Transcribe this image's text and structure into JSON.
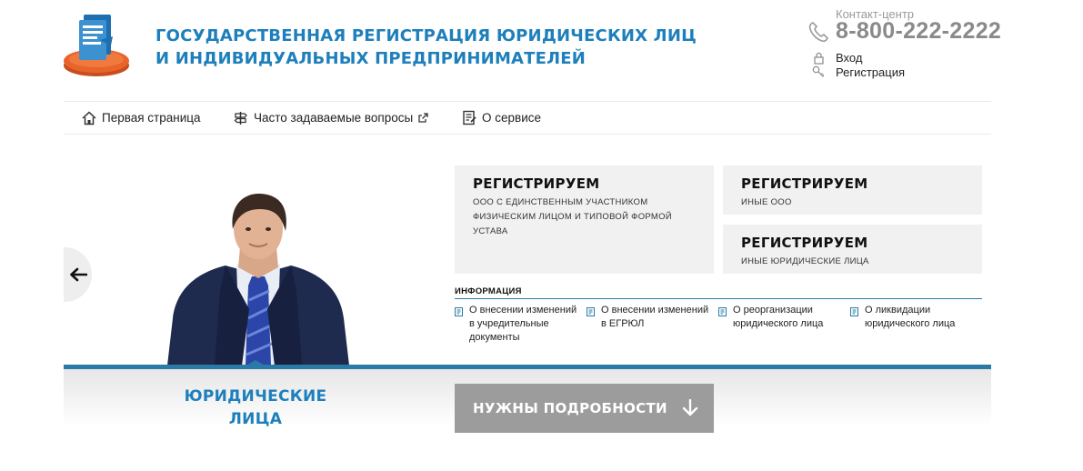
{
  "header": {
    "title_line1": "ГОСУДАРСТВЕННАЯ РЕГИСТРАЦИЯ ЮРИДИЧЕСКИХ ЛИЦ",
    "title_line2": "И ИНДИВИДУАЛЬНЫХ ПРЕДПРИНИМАТЕЛЕЙ",
    "contact_label": "Контакт-центр",
    "phone": "8-800-222-2222",
    "login_label": "Вход",
    "register_label": "Регистрация"
  },
  "nav": {
    "items": [
      {
        "label": "Первая страница",
        "icon": "home-icon"
      },
      {
        "label": "Часто задаваемые вопросы",
        "icon": "signpost-icon"
      },
      {
        "label": "О сервисе",
        "icon": "document-icon"
      }
    ]
  },
  "cards": [
    {
      "title": "РЕГИСТРИРУЕМ",
      "desc": "ООО С ЕДИНСТВЕННЫМ УЧАСТНИКОМ ФИЗИЧЕСКИМ ЛИЦОМ И ТИПОВОЙ ФОРМОЙ УСТАВА"
    },
    {
      "title": "РЕГИСТРИРУЕМ",
      "desc": "ИНЫЕ ООО"
    },
    {
      "title": "РЕГИСТРИРУЕМ",
      "desc": "ИНЫЕ ЮРИДИЧЕСКИЕ ЛИЦА"
    }
  ],
  "info": {
    "heading": "ИНФОРМАЦИЯ",
    "items": [
      "О внесении изменений в учредительные документы",
      "О внесении изменений в ЕГРЮЛ",
      "О реорганизации юридического лица",
      "О ликвидации юридического лица"
    ]
  },
  "category": {
    "line1": "ЮРИДИЧЕСКИЕ",
    "line2": "ЛИЦА"
  },
  "more_button": "НУЖНЫ ПОДРОБНОСТИ",
  "colors": {
    "brand_blue": "#1d7fbc",
    "bar_blue": "#2a7aa8",
    "logo_orange": "#e8642a",
    "card_bg": "#f1f1f1",
    "button_gray": "#9c9c9c"
  }
}
